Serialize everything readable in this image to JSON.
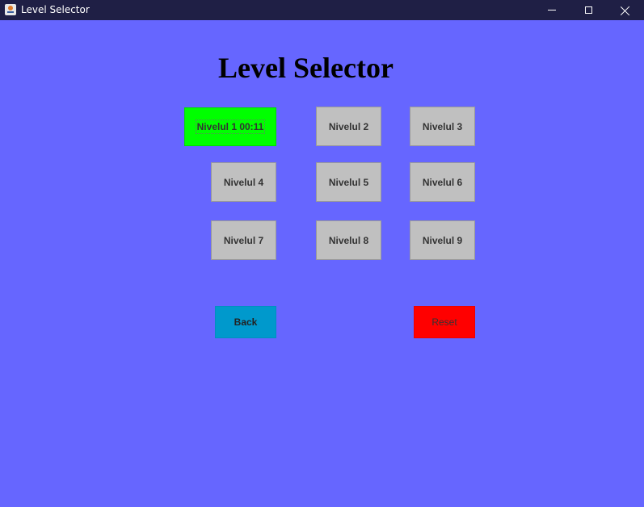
{
  "window": {
    "title": "Level Selector",
    "controls": [
      "minimize",
      "maximize",
      "close"
    ]
  },
  "main": {
    "heading": "Level Selector",
    "background_color": "#6666ff",
    "levels": [
      {
        "label": "Nivelul 1 00:11",
        "completed": true,
        "color": "#00ff00"
      },
      {
        "label": "Nivelul 2",
        "completed": false,
        "color": "#c0c0c0"
      },
      {
        "label": "Nivelul 3",
        "completed": false,
        "color": "#c0c0c0"
      },
      {
        "label": "Nivelul 4",
        "completed": false,
        "color": "#c0c0c0"
      },
      {
        "label": "Nivelul 5",
        "completed": false,
        "color": "#c0c0c0"
      },
      {
        "label": "Nivelul 6",
        "completed": false,
        "color": "#c0c0c0"
      },
      {
        "label": "Nivelul 7",
        "completed": false,
        "color": "#c0c0c0"
      },
      {
        "label": "Nivelul 8",
        "completed": false,
        "color": "#c0c0c0"
      },
      {
        "label": "Nivelul 9",
        "completed": false,
        "color": "#c0c0c0"
      }
    ],
    "back_label": "Back",
    "back_color": "#0099cc",
    "reset_label": "Reset",
    "reset_color": "#ff0000"
  }
}
